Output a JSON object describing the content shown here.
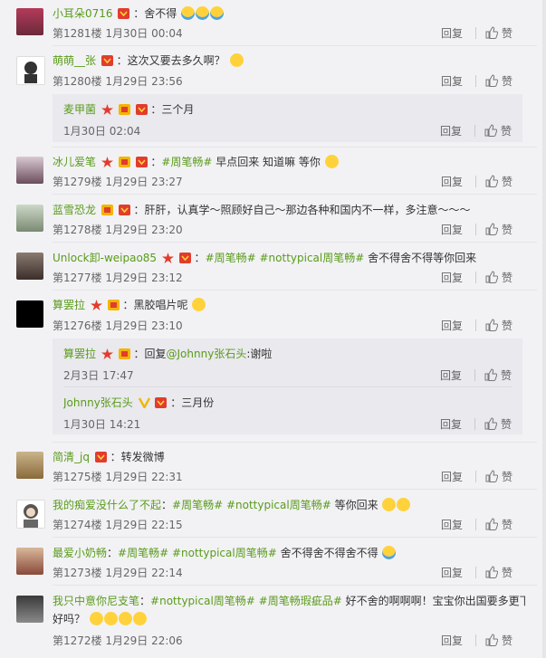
{
  "comments": [
    {
      "name": "小耳朵0716",
      "text": "：舍不得",
      "floor": "第1281楼",
      "time": "1月30日 00:04"
    },
    {
      "name": "萌萌__张",
      "text": "：这次又要去多久啊？",
      "floor": "第1280楼",
      "time": "1月29日 23:56",
      "reply": {
        "name": "麦甲菌",
        "text": "：三个月",
        "time": "1月30日 02:04"
      }
    },
    {
      "name": "冰儿爱笔",
      "text_link": "#周笔畅#",
      "text": " 早点回来 知道嘛 等你",
      "floor": "第1279楼",
      "time": "1月29日 23:27"
    },
    {
      "name": "蓝雪恐龙",
      "text": "：肝肝，认真学～照顾好自己～那边各种和国内不一样，多注意～～～",
      "floor": "第1278楼",
      "time": "1月29日 23:20"
    },
    {
      "name": "Unlock卸-weipao85",
      "text_link": "#周笔畅# #nottypical周笔畅#",
      "text": " 舍不得舍不得等你回来",
      "floor": "第1277楼",
      "time": "1月29日 23:12"
    },
    {
      "name": "算罢拉",
      "text": "：黑胶唱片呢",
      "floor": "第1276楼",
      "time": "1月29日 23:10",
      "replies": [
        {
          "name": "算罢拉",
          "text_pre": "：回复",
          "text_link": "@Johnny张石头",
          "text": ":谢啦",
          "time": "2月3日 17:47"
        },
        {
          "name": "Johnny张石头",
          "text": "：三月份",
          "time": "1月30日 14:21"
        }
      ]
    },
    {
      "name": "简清_jq",
      "text": "：转发微博",
      "floor": "第1275楼",
      "time": "1月29日 22:31"
    },
    {
      "name": "我的痴爱没什么了不起",
      "text_link": "#周笔畅# #nottypical周笔畅#",
      "text": " 等你回来",
      "floor": "第1274楼",
      "time": "1月29日 22:15"
    },
    {
      "name": "最爱小奶畅",
      "text_link": "#周笔畅# #nottypical周笔畅#",
      "text": " 舍不得舍不得舍不得",
      "floor": "第1273楼",
      "time": "1月29日 22:14"
    },
    {
      "name": "我只中意你尼支笔",
      "text_link": "#nottypical周笔畅# #周笔畅瑕疵品#",
      "text": " 好不舍的啊啊啊！宝宝你出国要多更下博",
      "text2": "好吗？",
      "floor": "第1272楼",
      "time": "1月29日 22:06"
    }
  ],
  "labels": {
    "reply": "回复",
    "like": "赞"
  },
  "colors": {
    "link": "#5a9b1a",
    "bg": "#f2f2f5",
    "subbox": "#e9e9ee"
  },
  "icons": [
    "thumb-up-icon",
    "vip-badge-icon",
    "red-star-icon",
    "gold-v-icon",
    "crying-emoji-icon",
    "smile-emoji-icon"
  ]
}
